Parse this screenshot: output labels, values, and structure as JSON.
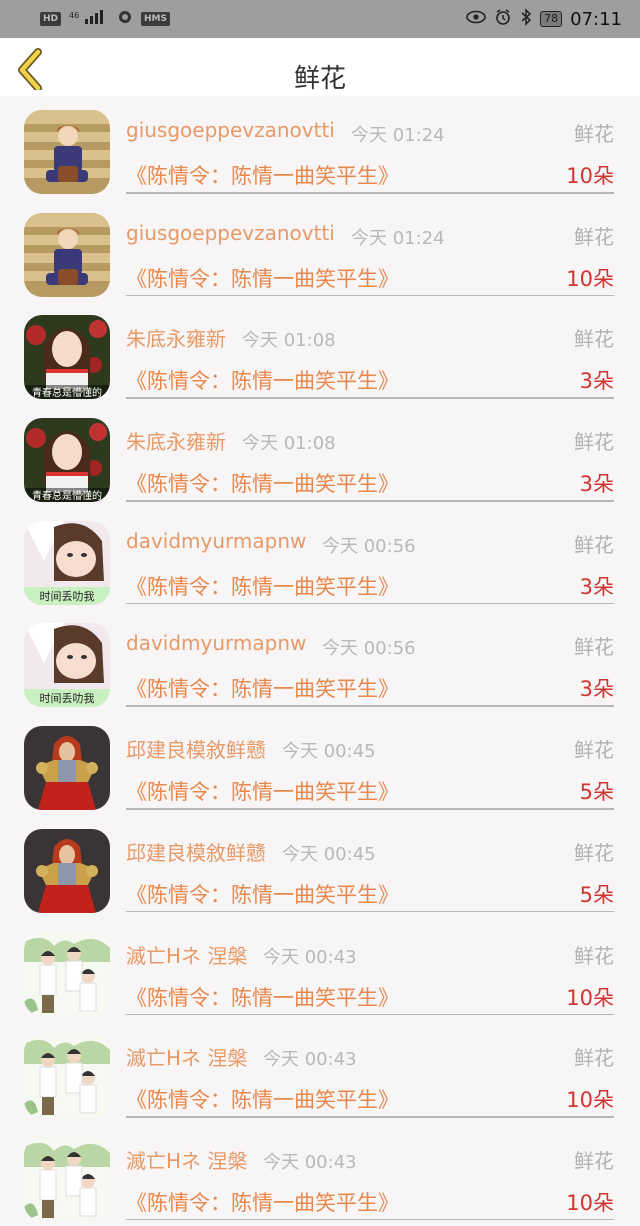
{
  "status_bar": {
    "left": [
      "HD",
      "46",
      "HMS"
    ],
    "battery": "78",
    "time": "07:11"
  },
  "header": {
    "title": "鲜花"
  },
  "colors": {
    "username": "#e89a66",
    "count": "#d0352f",
    "time": "#b9b9b9"
  },
  "records": [
    {
      "user": "giusgoeppevzanovtti",
      "time": "今天 01:24",
      "type": "鲜花",
      "book": "《陈情令：陈情一曲笑平生》",
      "count": "10朵",
      "avatar": "anime-boy"
    },
    {
      "user": "giusgoeppevzanovtti",
      "time": "今天 01:24",
      "type": "鲜花",
      "book": "《陈情令：陈情一曲笑平生》",
      "count": "10朵",
      "avatar": "anime-boy"
    },
    {
      "user": "朱底永雍新",
      "time": "今天 01:08",
      "type": "鲜花",
      "book": "《陈情令：陈情一曲笑平生》",
      "count": "3朵",
      "avatar": "girl-red"
    },
    {
      "user": "朱底永雍新",
      "time": "今天 01:08",
      "type": "鲜花",
      "book": "《陈情令：陈情一曲笑平生》",
      "count": "3朵",
      "avatar": "girl-red"
    },
    {
      "user": "davidmyurmapnw",
      "time": "今天 00:56",
      "type": "鲜花",
      "book": "《陈情令：陈情一曲笑平生》",
      "count": "3朵",
      "avatar": "girl-soft"
    },
    {
      "user": "davidmyurmapnw",
      "time": "今天 00:56",
      "type": "鲜花",
      "book": "《陈情令：陈情一曲笑平生》",
      "count": "3朵",
      "avatar": "girl-soft"
    },
    {
      "user": "邱建良模敘鲜戆",
      "time": "今天 00:45",
      "type": "鲜花",
      "book": "《陈情令：陈情一曲笑平生》",
      "count": "5朵",
      "avatar": "warrior"
    },
    {
      "user": "邱建良模敘鲜戆",
      "time": "今天 00:45",
      "type": "鲜花",
      "book": "《陈情令：陈情一曲笑平生》",
      "count": "5朵",
      "avatar": "warrior"
    },
    {
      "user": "滅亡Hネ 涅槃",
      "time": "今天 00:43",
      "type": "鲜花",
      "book": "《陈情令：陈情一曲笑平生》",
      "count": "10朵",
      "avatar": "group"
    },
    {
      "user": "滅亡Hネ 涅槃",
      "time": "今天 00:43",
      "type": "鲜花",
      "book": "《陈情令：陈情一曲笑平生》",
      "count": "10朵",
      "avatar": "group"
    },
    {
      "user": "滅亡Hネ 涅槃",
      "time": "今天 00:43",
      "type": "鲜花",
      "book": "《陈情令：陈情一曲笑平生》",
      "count": "10朵",
      "avatar": "group"
    }
  ],
  "avatar_captions": {
    "girl-red": "青春总是懵懂的",
    "girl-soft": "时间丢叻我"
  }
}
